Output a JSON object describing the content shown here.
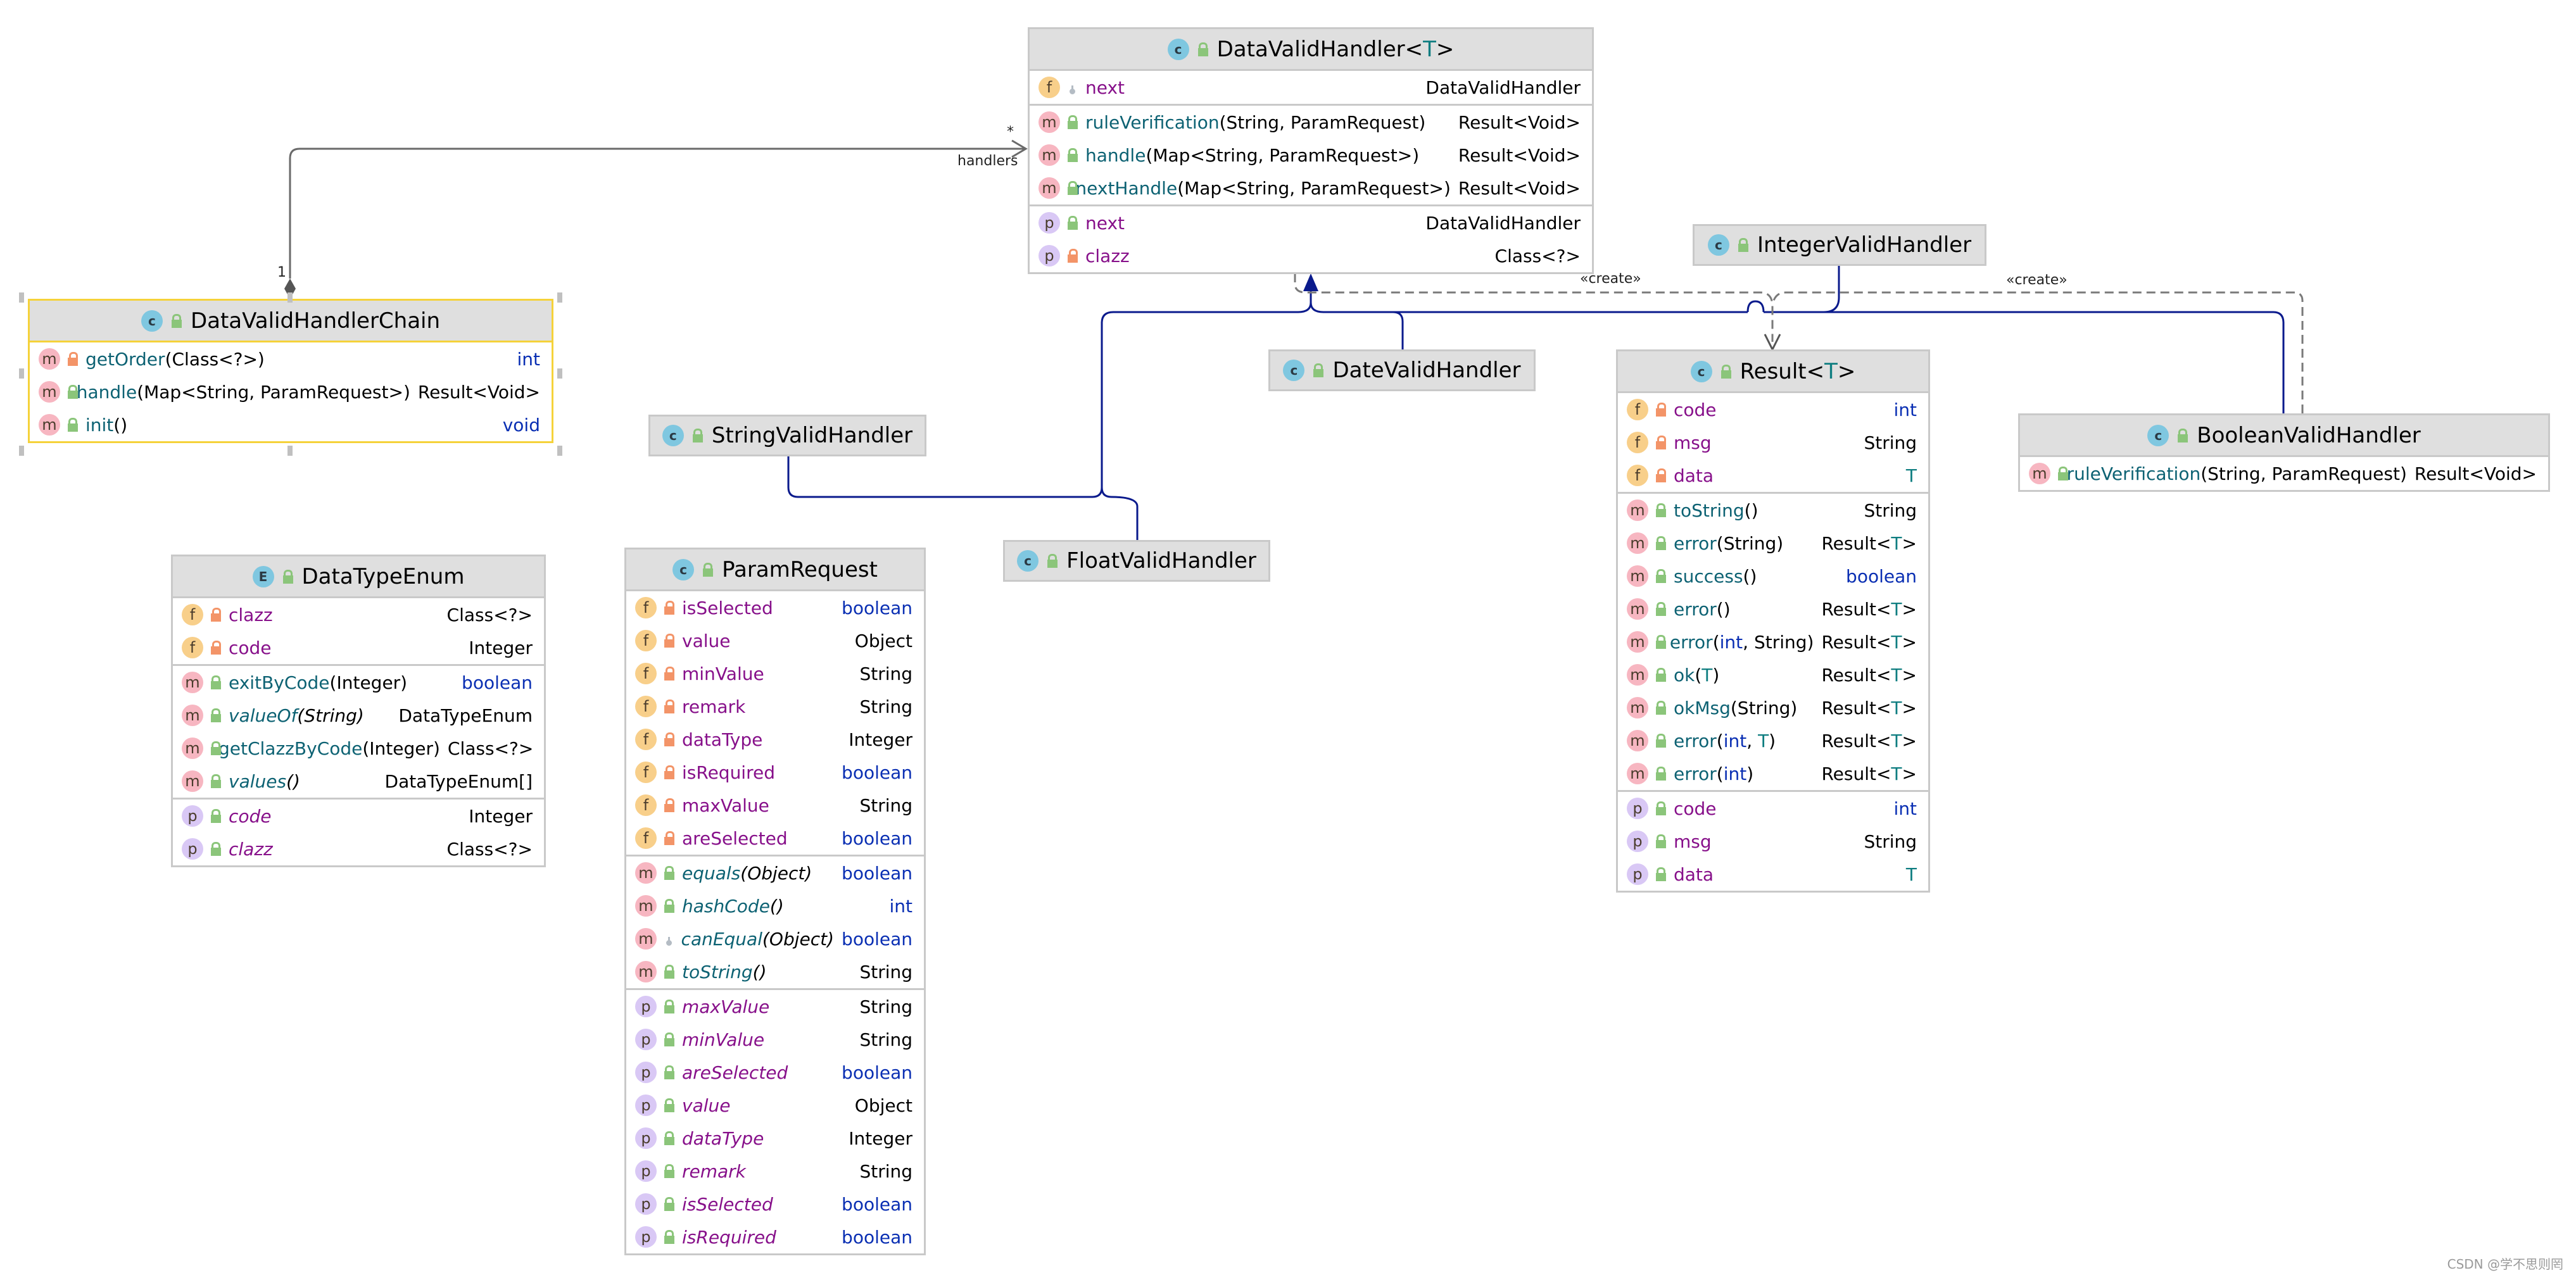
{
  "diagram": {
    "title": "UML class diagram",
    "watermark": "CSDN @学不思则罔",
    "colors": {
      "field_name": "#87108a",
      "method_name": "#0d6273",
      "primitive_type": "#0a2fb3",
      "generic_param": "#0e7d80",
      "inheritance_line": "#0a1a8c",
      "dependency_line": "#7a7a7a",
      "selected_border": "#f5d23a"
    }
  },
  "classes": {
    "dataValidHandler": {
      "kind": "C",
      "name": "DataValidHandler<T>",
      "fields": [
        {
          "badge": "f",
          "vis": "package",
          "name": "next",
          "type": "DataValidHandler"
        }
      ],
      "methods": [
        {
          "badge": "m",
          "vis": "public",
          "name": "ruleVerification",
          "args": "(String, ParamRequest)",
          "type": "Result<Void>"
        },
        {
          "badge": "m",
          "vis": "public",
          "name": "handle",
          "args": "(Map<String, ParamRequest>)",
          "type": "Result<Void>"
        },
        {
          "badge": "m",
          "vis": "public",
          "name": "nextHandle",
          "args": "(Map<String, ParamRequest>)",
          "type": "Result<Void>"
        }
      ],
      "properties": [
        {
          "badge": "p",
          "vis": "public",
          "name": "next",
          "type": "DataValidHandler"
        },
        {
          "badge": "p",
          "vis": "private",
          "name": "clazz",
          "type": "Class<?>"
        }
      ]
    },
    "dataValidHandlerChain": {
      "kind": "C",
      "name": "DataValidHandlerChain",
      "selected": true,
      "methods": [
        {
          "badge": "m",
          "vis": "private",
          "name": "getOrder",
          "args": "(Class<?>)",
          "type": "int"
        },
        {
          "badge": "m",
          "vis": "public",
          "name": "handle",
          "args": "(Map<String, ParamRequest>)",
          "type": "Result<Void>"
        },
        {
          "badge": "m",
          "vis": "public",
          "name": "init",
          "args": "()",
          "type": "void"
        }
      ]
    },
    "dataTypeEnum": {
      "kind": "E",
      "name": "DataTypeEnum",
      "fields": [
        {
          "badge": "f",
          "vis": "private",
          "name": "clazz",
          "type": "Class<?>"
        },
        {
          "badge": "f",
          "vis": "private",
          "name": "code",
          "type": "Integer"
        }
      ],
      "methods": [
        {
          "badge": "m",
          "vis": "public",
          "name": "exitByCode",
          "args": "(Integer)",
          "type": "boolean"
        },
        {
          "badge": "m",
          "vis": "public",
          "name": "valueOf",
          "args": "(String)",
          "type": "DataTypeEnum",
          "italic": true
        },
        {
          "badge": "m",
          "vis": "public",
          "name": "getClazzByCode",
          "args": "(Integer)",
          "type": "Class<?>"
        },
        {
          "badge": "m",
          "vis": "public",
          "name": "values",
          "args": "()",
          "type": "DataTypeEnum[]",
          "italic": true
        }
      ],
      "properties": [
        {
          "badge": "p",
          "vis": "public",
          "name": "code",
          "type": "Integer",
          "italic": true
        },
        {
          "badge": "p",
          "vis": "public",
          "name": "clazz",
          "type": "Class<?>",
          "italic": true
        }
      ]
    },
    "paramRequest": {
      "kind": "C",
      "name": "ParamRequest",
      "fields": [
        {
          "badge": "f",
          "vis": "private",
          "name": "isSelected",
          "type": "boolean"
        },
        {
          "badge": "f",
          "vis": "private",
          "name": "value",
          "type": "Object"
        },
        {
          "badge": "f",
          "vis": "private",
          "name": "minValue",
          "type": "String"
        },
        {
          "badge": "f",
          "vis": "private",
          "name": "remark",
          "type": "String"
        },
        {
          "badge": "f",
          "vis": "private",
          "name": "dataType",
          "type": "Integer"
        },
        {
          "badge": "f",
          "vis": "private",
          "name": "isRequired",
          "type": "boolean"
        },
        {
          "badge": "f",
          "vis": "private",
          "name": "maxValue",
          "type": "String"
        },
        {
          "badge": "f",
          "vis": "private",
          "name": "areSelected",
          "type": "boolean"
        }
      ],
      "methods": [
        {
          "badge": "m",
          "vis": "public",
          "name": "equals",
          "args": "(Object)",
          "type": "boolean",
          "italic": true
        },
        {
          "badge": "m",
          "vis": "public",
          "name": "hashCode",
          "args": "()",
          "type": "int",
          "italic": true
        },
        {
          "badge": "m",
          "vis": "package",
          "name": "canEqual",
          "args": "(Object)",
          "type": "boolean",
          "italic": true
        },
        {
          "badge": "m",
          "vis": "public",
          "name": "toString",
          "args": "()",
          "type": "String",
          "italic": true
        }
      ],
      "properties": [
        {
          "badge": "p",
          "vis": "public",
          "name": "maxValue",
          "type": "String",
          "italic": true
        },
        {
          "badge": "p",
          "vis": "public",
          "name": "minValue",
          "type": "String",
          "italic": true
        },
        {
          "badge": "p",
          "vis": "public",
          "name": "areSelected",
          "type": "boolean",
          "italic": true
        },
        {
          "badge": "p",
          "vis": "public",
          "name": "value",
          "type": "Object",
          "italic": true
        },
        {
          "badge": "p",
          "vis": "public",
          "name": "dataType",
          "type": "Integer",
          "italic": true
        },
        {
          "badge": "p",
          "vis": "public",
          "name": "remark",
          "type": "String",
          "italic": true
        },
        {
          "badge": "p",
          "vis": "public",
          "name": "isSelected",
          "type": "boolean",
          "italic": true
        },
        {
          "badge": "p",
          "vis": "public",
          "name": "isRequired",
          "type": "boolean",
          "italic": true
        }
      ]
    },
    "result": {
      "kind": "C",
      "name": "Result<T>",
      "fields": [
        {
          "badge": "f",
          "vis": "private",
          "name": "code",
          "type": "int"
        },
        {
          "badge": "f",
          "vis": "private",
          "name": "msg",
          "type": "String"
        },
        {
          "badge": "f",
          "vis": "private",
          "name": "data",
          "type": "T"
        }
      ],
      "methods": [
        {
          "badge": "m",
          "vis": "public",
          "name": "toString",
          "args": "()",
          "type": "String"
        },
        {
          "badge": "m",
          "vis": "public",
          "name": "error",
          "args": "(String)",
          "type": "Result<T>"
        },
        {
          "badge": "m",
          "vis": "public",
          "name": "success",
          "args": "()",
          "type": "boolean"
        },
        {
          "badge": "m",
          "vis": "public",
          "name": "error",
          "args": "()",
          "type": "Result<T>"
        },
        {
          "badge": "m",
          "vis": "public",
          "name": "error",
          "args": "(int, String)",
          "type": "Result<T>"
        },
        {
          "badge": "m",
          "vis": "public",
          "name": "ok",
          "args": "(T)",
          "type": "Result<T>"
        },
        {
          "badge": "m",
          "vis": "public",
          "name": "okMsg",
          "args": "(String)",
          "type": "Result<T>"
        },
        {
          "badge": "m",
          "vis": "public",
          "name": "error",
          "args": "(int, T)",
          "type": "Result<T>"
        },
        {
          "badge": "m",
          "vis": "public",
          "name": "error",
          "args": "(int)",
          "type": "Result<T>"
        }
      ],
      "properties": [
        {
          "badge": "p",
          "vis": "public",
          "name": "code",
          "type": "int"
        },
        {
          "badge": "p",
          "vis": "public",
          "name": "msg",
          "type": "String"
        },
        {
          "badge": "p",
          "vis": "public",
          "name": "data",
          "type": "T"
        }
      ]
    },
    "booleanValidHandler": {
      "kind": "C",
      "name": "BooleanValidHandler",
      "methods": [
        {
          "badge": "m",
          "vis": "public",
          "name": "ruleVerification",
          "args": "(String, ParamRequest)",
          "type": "Result<Void>"
        }
      ]
    },
    "stringValidHandler": {
      "kind": "C",
      "name": "StringValidHandler"
    },
    "floatValidHandler": {
      "kind": "C",
      "name": "FloatValidHandler"
    },
    "dateValidHandler": {
      "kind": "C",
      "name": "DateValidHandler"
    },
    "integerValidHandler": {
      "kind": "C",
      "name": "IntegerValidHandler"
    }
  },
  "relations": {
    "association": {
      "from": "DataValidHandlerChain",
      "to": "DataValidHandler",
      "role": "handlers",
      "source_multiplicity": "1",
      "target_multiplicity": "*"
    },
    "create_labels": [
      "«create»",
      "«create»"
    ]
  }
}
